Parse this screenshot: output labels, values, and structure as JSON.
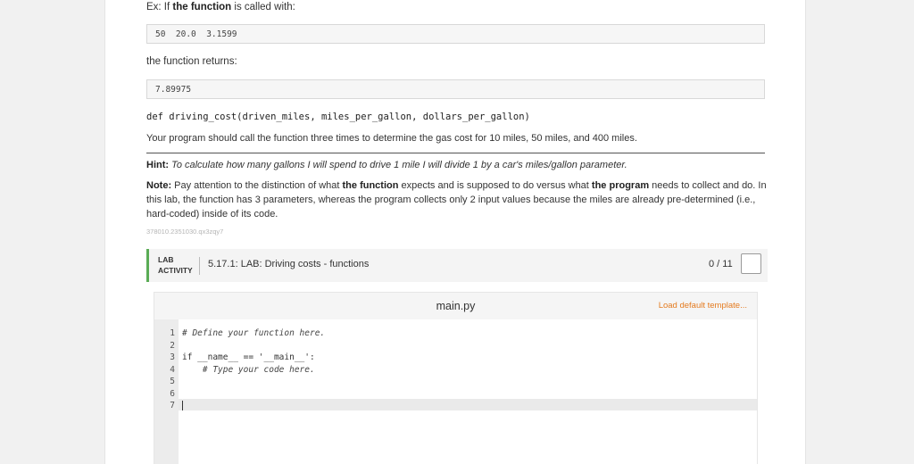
{
  "example": {
    "intro_prefix": "Ex: If ",
    "intro_bold": "the function",
    "intro_suffix": " is called with:",
    "input": "50  20.0  3.1599",
    "returns_label": "the function returns:",
    "output": "7.89975"
  },
  "signature": "def driving_cost(driven_miles, miles_per_gallon, dollars_per_gallon)",
  "instruction": "Your program should call the function three times to determine the gas cost for 10 miles, 50 miles, and 400 miles.",
  "hint": {
    "label": "Hint:",
    "text": " To calculate how many gallons I will spend to drive 1 mile I will divide 1 by a car's miles/gallon parameter."
  },
  "note": {
    "label": "Note:",
    "part1": " Pay attention to the distinction of what ",
    "bold1": "the function",
    "part2": " expects and is supposed to do versus what ",
    "bold2": "the program",
    "part3": " needs to collect and do. In this lab, the function has 3 parameters, whereas the program collects only 2 input values because the miles are already pre-determined (i.e., hard-coded) inside of its code."
  },
  "content_id": "378010.2351030.qx3zqy7",
  "lab": {
    "tag_line1": "LAB",
    "tag_line2": "ACTIVITY",
    "title": "5.17.1: LAB: Driving costs - functions",
    "score": "0 / 11",
    "accent_color": "#5aac55"
  },
  "editor": {
    "filename": "main.py",
    "load_template": "Load default template...",
    "line_numbers": [
      "1",
      "2",
      "3",
      "4",
      "5",
      "6",
      "7"
    ],
    "lines": [
      "# Define your function here.",
      "",
      "if __name__ == '__main__':",
      "    # Type your code here.",
      "",
      "",
      ""
    ],
    "accent_color": "#e47b20"
  }
}
